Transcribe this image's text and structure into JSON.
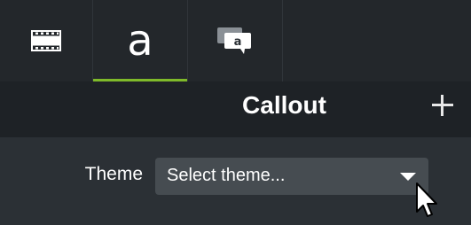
{
  "tabs": [
    {
      "icon": "film-icon",
      "label": "Media",
      "active": false
    },
    {
      "icon": "annotation-a-icon",
      "glyph": "a",
      "label": "Annotations",
      "active": true
    },
    {
      "icon": "callout-icon",
      "glyph": "a",
      "label": "Callouts",
      "active": false
    }
  ],
  "panel": {
    "title": "Callout",
    "add_icon": "plus-icon"
  },
  "theme": {
    "label": "Theme",
    "value": "Select theme...",
    "dropdown_icon": "chevron-down-icon"
  },
  "colors": {
    "accent": "#7fba2a",
    "background": "#2b3035",
    "header": "#1e2226",
    "tabbar": "#23272b",
    "dropdown": "#464c51"
  }
}
